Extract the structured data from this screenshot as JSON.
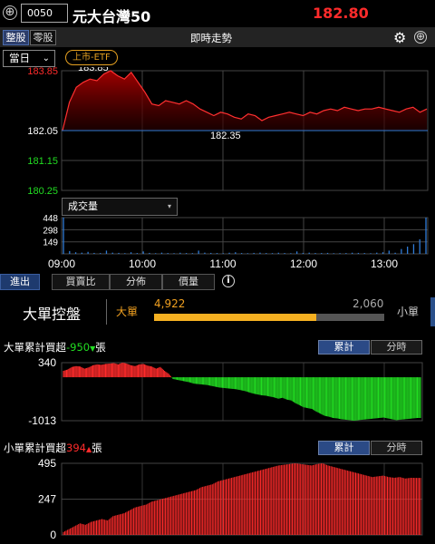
{
  "header": {
    "code": "0050",
    "name": "元大台灣50",
    "price": "182.80",
    "add_symbol": "⊕"
  },
  "subheader": {
    "tab_whole": "整股",
    "tab_odd": "零股",
    "title": "即時走勢",
    "gear_symbol": "⚙",
    "add_symbol": "⊕"
  },
  "controls": {
    "period": "當日",
    "period_caret": "⌄",
    "badge": "上市-ETF"
  },
  "price_chart": {
    "y_labels": [
      {
        "v": "183.85",
        "color": "#ff2b2b"
      },
      {
        "v": "182.05",
        "color": "#ffffff"
      },
      {
        "v": "181.15",
        "color": "#22dd22"
      },
      {
        "v": "180.25",
        "color": "#22dd22"
      }
    ],
    "ymax": 183.85,
    "ymin": 180.25,
    "ref": 182.05,
    "high_label": "183.85",
    "low_label": "182.35",
    "series": [
      182.05,
      182.9,
      183.35,
      183.5,
      183.6,
      183.55,
      183.75,
      183.85,
      183.7,
      183.6,
      183.8,
      183.5,
      183.2,
      182.85,
      182.8,
      182.95,
      182.9,
      182.85,
      182.95,
      182.85,
      182.7,
      182.6,
      182.5,
      182.6,
      182.55,
      182.45,
      182.4,
      182.55,
      182.5,
      182.35,
      182.45,
      182.5,
      182.55,
      182.6,
      182.55,
      182.5,
      182.6,
      182.55,
      182.65,
      182.7,
      182.65,
      182.75,
      182.7,
      182.65,
      182.7,
      182.7,
      182.75,
      182.7,
      182.65,
      182.6,
      182.7,
      182.75,
      182.6,
      182.7
    ]
  },
  "volume": {
    "select": "成交量",
    "caret": "▾",
    "y_labels": [
      "448",
      "298",
      "149"
    ],
    "max": 448,
    "values": [
      448,
      35,
      20,
      15,
      25,
      12,
      10,
      40,
      15,
      12,
      8,
      20,
      10,
      30,
      12,
      8,
      15,
      10,
      8,
      14,
      10,
      9,
      40,
      15,
      12,
      10,
      8,
      14,
      20,
      10,
      8,
      12,
      15,
      10,
      9,
      14,
      10,
      8,
      30,
      12,
      15,
      10,
      10,
      12,
      8,
      9,
      10,
      14,
      12,
      10,
      8,
      15,
      20,
      40,
      14,
      60,
      90,
      120,
      180,
      448
    ]
  },
  "time_axis": [
    "09:00",
    "10:00",
    "11:00",
    "12:00",
    "13:00"
  ],
  "flow_tabs": {
    "inout": "進出",
    "ratio": "買賣比",
    "dist": "分佈",
    "price": "價量",
    "info": "i"
  },
  "flow_panel": {
    "title": "大單控盤",
    "big_label": "大單",
    "big_value": "4,922",
    "small_value": "2,060",
    "small_label": "小單",
    "big_ratio": 0.705
  },
  "big_orders": {
    "label_prefix": "大單累計買超",
    "value": "-950",
    "arrow": "▼",
    "label_suffix": "張",
    "y_labels": [
      "340",
      "-1013"
    ],
    "max": 340,
    "min": -1013,
    "btn_cum": "累計",
    "btn_time": "分時",
    "values": [
      150,
      180,
      240,
      260,
      250,
      200,
      230,
      280,
      300,
      290,
      310,
      320,
      330,
      300,
      340,
      320,
      280,
      260,
      300,
      310,
      270,
      250,
      200,
      240,
      150,
      80,
      -40,
      -60,
      -80,
      -100,
      -120,
      -150,
      -160,
      -170,
      -180,
      -200,
      -220,
      -240,
      -250,
      -260,
      -270,
      -280,
      -300,
      -320,
      -350,
      -380,
      -400,
      -420,
      -430,
      -450,
      -470,
      -500,
      -480,
      -520,
      -540,
      -600,
      -650,
      -700,
      -720,
      -740,
      -800,
      -850,
      -900,
      -920,
      -950,
      -960,
      -980,
      -990,
      -1000,
      -1013,
      -1000,
      -990,
      -980,
      -970,
      -960,
      -950,
      -940,
      -960,
      -980,
      -1000,
      -990,
      -980,
      -970,
      -960,
      -950
    ]
  },
  "small_orders": {
    "label_prefix": "小單累計買超",
    "value": "394",
    "arrow": "▲",
    "label_suffix": "張",
    "y_labels": [
      "495",
      "247",
      "0"
    ],
    "max": 495,
    "min": 0,
    "btn_cum": "累計",
    "btn_time": "分時",
    "values": [
      20,
      40,
      60,
      80,
      70,
      90,
      100,
      110,
      100,
      130,
      140,
      150,
      170,
      190,
      200,
      210,
      230,
      240,
      250,
      260,
      270,
      280,
      290,
      300,
      310,
      330,
      340,
      350,
      370,
      380,
      390,
      400,
      410,
      420,
      430,
      440,
      450,
      460,
      470,
      480,
      485,
      490,
      495,
      490,
      485,
      480,
      490,
      495,
      480,
      470,
      460,
      450,
      440,
      430,
      420,
      410,
      400,
      405,
      410,
      400,
      395,
      400,
      390,
      395,
      394
    ]
  },
  "colors": {
    "up": "#ff2b2b",
    "down": "#22dd22",
    "accent": "#f0a020",
    "volume": "#2f7bd6",
    "ref_line": "#2f7bd6"
  }
}
